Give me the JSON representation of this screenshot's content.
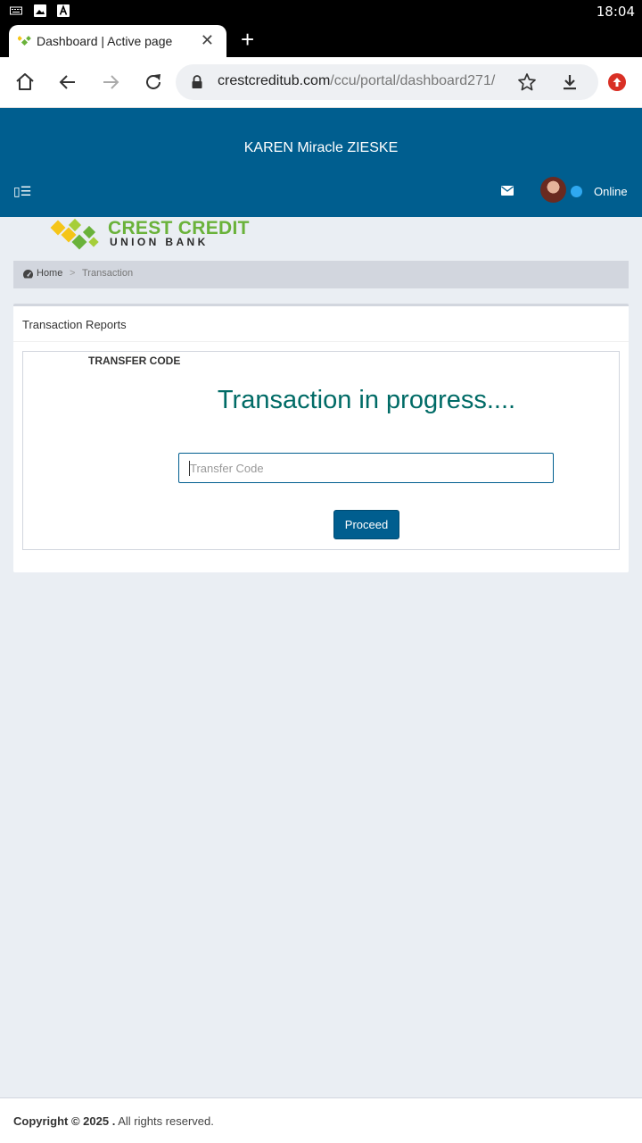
{
  "status_bar": {
    "time": "18:04",
    "icons": [
      "keyboard-icon",
      "image-icon",
      "font-a-icon"
    ]
  },
  "browser": {
    "tab_title": "Dashboard | Active page",
    "url_host": "crestcreditub.com",
    "url_path": "/ccu/portal/dashboard271/",
    "update_color": "#d93025"
  },
  "header": {
    "user_name": "KAREN Miracle ZIESKE",
    "menu_toggle": "▯☰",
    "status_label": "Online",
    "bg_color": "#005e8f",
    "online_color": "#2fa8f0"
  },
  "logo": {
    "line1": "CREST CREDIT",
    "line2": "UNION BANK"
  },
  "breadcrumb": {
    "home": "Home",
    "separator": ">",
    "current": "Transaction"
  },
  "panel": {
    "title": "Transaction Reports",
    "code_label": "TRANSFER CODE",
    "progress_text": "Transaction in progress....",
    "input_placeholder": "Transfer Code",
    "input_value": "",
    "button_label": "Proceed",
    "accent_color": "#006b66"
  },
  "footer": {
    "copyright_bold": "Copyright © 2025 .",
    "copyright_rest": " All rights reserved."
  }
}
